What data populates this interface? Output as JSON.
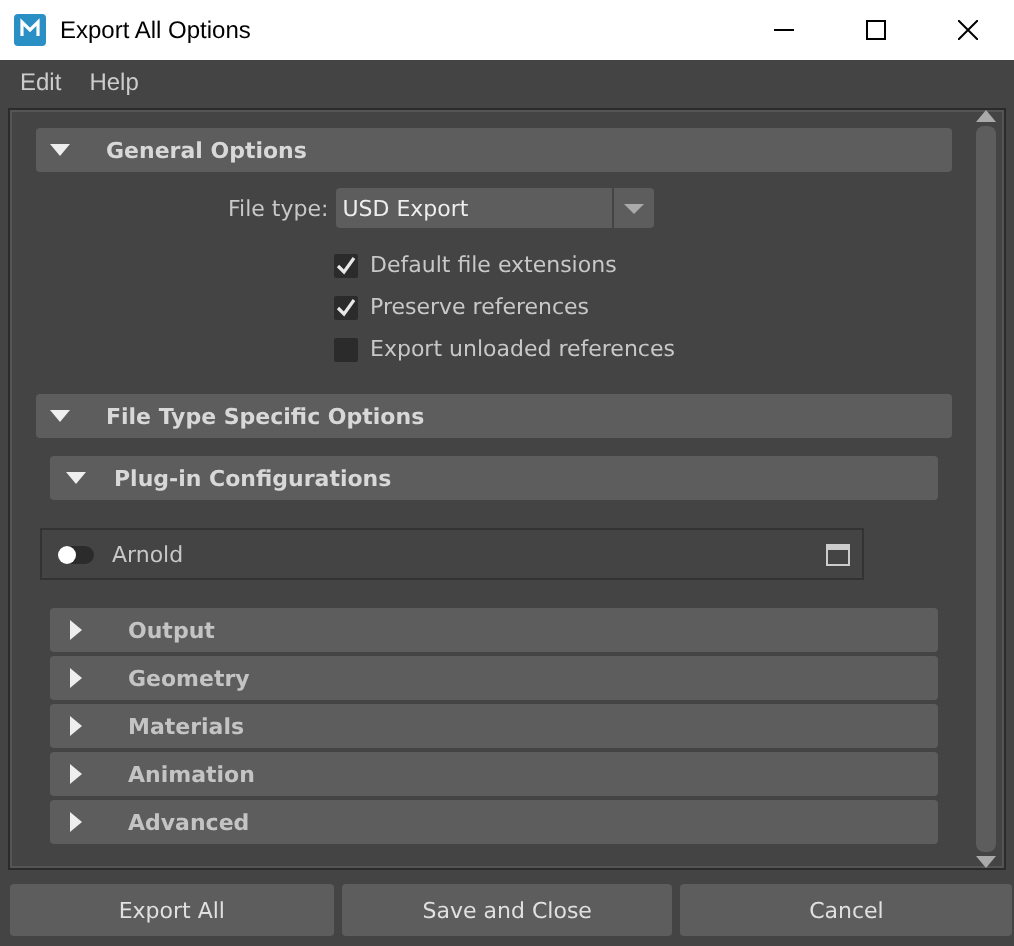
{
  "window": {
    "title": "Export All Options"
  },
  "menu": [
    "Edit",
    "Help"
  ],
  "general": {
    "title": "General Options",
    "expanded": true,
    "file_type": {
      "label": "File type:",
      "value": "USD Export"
    },
    "checkboxes": [
      {
        "label": "Default file extensions",
        "checked": true
      },
      {
        "label": "Preserve references",
        "checked": true
      },
      {
        "label": "Export unloaded references",
        "checked": false
      }
    ]
  },
  "specific": {
    "title": "File Type Specific Options",
    "expanded": true,
    "plugin_config": {
      "title": "Plug-in Configurations",
      "expanded": true,
      "plugins": [
        {
          "name": "Arnold",
          "on": false
        }
      ]
    },
    "sections": [
      {
        "title": "Output",
        "expanded": false
      },
      {
        "title": "Geometry",
        "expanded": false
      },
      {
        "title": "Materials",
        "expanded": false
      },
      {
        "title": "Animation",
        "expanded": false
      },
      {
        "title": "Advanced",
        "expanded": false
      }
    ]
  },
  "buttons": [
    "Export All",
    "Save and Close",
    "Cancel"
  ]
}
